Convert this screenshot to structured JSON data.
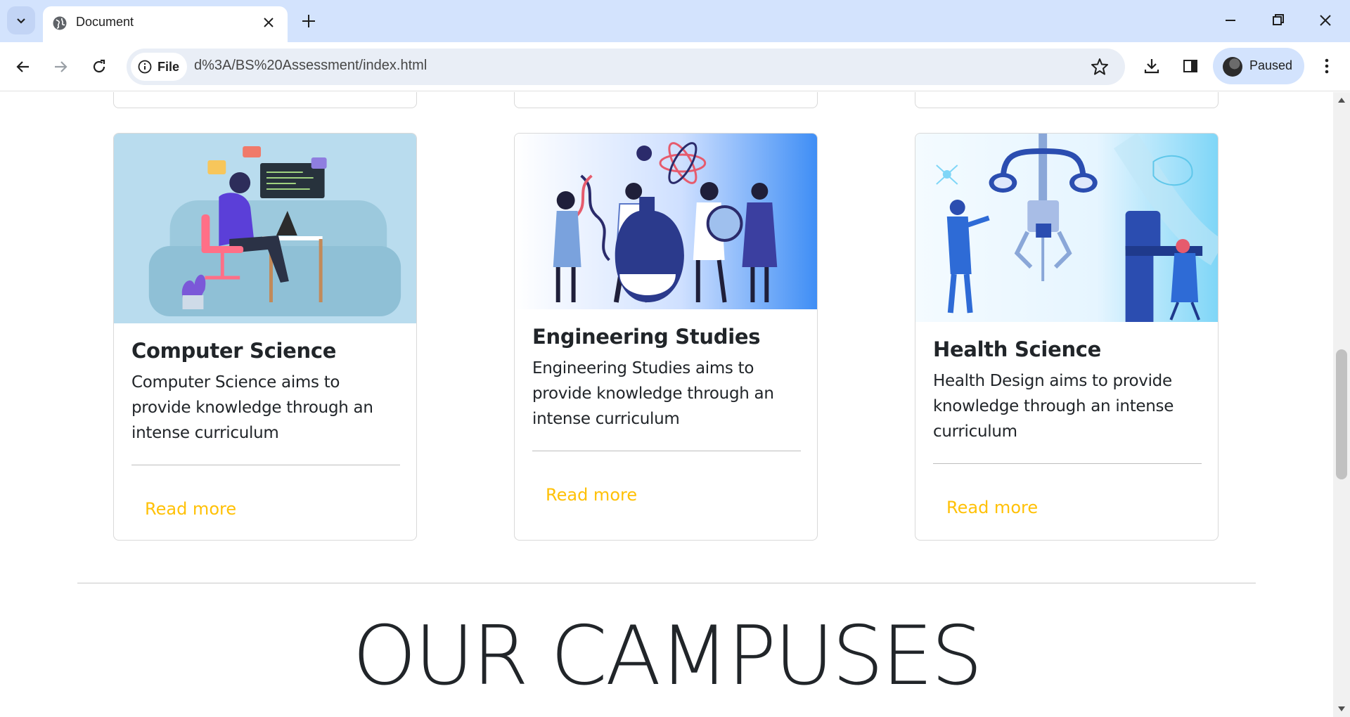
{
  "browser": {
    "tab_title": "Document",
    "site_chip_label": "File",
    "url": "d%3A/BS%20Assessment/index.html",
    "profile_label": "Paused"
  },
  "cards": [
    {
      "title": "Computer Science",
      "text": "Computer Science aims to provide knowledge through an intense curriculum",
      "link": "Read more",
      "image_icon": "programmer-illustration"
    },
    {
      "title": "Engineering Studies",
      "text": "Engineering Studies aims to provide knowledge through an intense curriculum",
      "link": "Read more",
      "image_icon": "scientists-illustration"
    },
    {
      "title": "Health Science",
      "text": "Health Design aims to provide knowledge through an intense curriculum",
      "link": "Read more",
      "image_icon": "robotic-surgery-illustration"
    }
  ],
  "section": {
    "title": "OUR CAMPUSES"
  },
  "colors": {
    "link": "#ffc107",
    "tabstrip": "#d3e3fd",
    "text": "#212529"
  }
}
